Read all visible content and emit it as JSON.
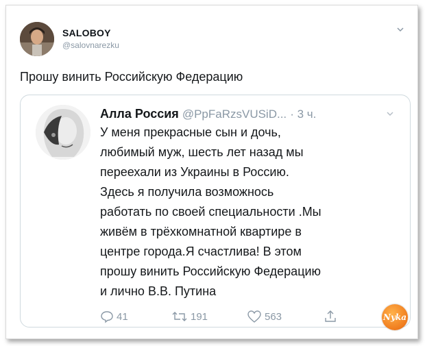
{
  "tweet": {
    "author_name": "SALOBOY",
    "author_handle": "@salovnarezku",
    "text": "Прошу винить Российскую Федерацию"
  },
  "quoted": {
    "author_name": "Алла Россия",
    "author_handle": "@PpFaRzsVUSiD...",
    "time": "· 3 ч.",
    "lines": [
      "У меня прекрасные сын и дочь,",
      "любимый  муж, шесть лет назад мы",
      "переехали из Украины в Россию.",
      "Здесь я получила возможнось",
      "работать по своей специальности .Мы",
      "живём в трёхкомнатной квартире в",
      "центре города.Я счастлива! В этом",
      "прошу винить Российскую Федерацию",
      "и лично В.В. Путина"
    ],
    "actions": {
      "replies": "41",
      "retweets": "191",
      "likes": "563"
    }
  },
  "watermark": "Nyka",
  "colors": {
    "muted": "#8a98a5",
    "text": "#14171a",
    "border": "#cfd9de",
    "logo": "#f07c1e"
  }
}
